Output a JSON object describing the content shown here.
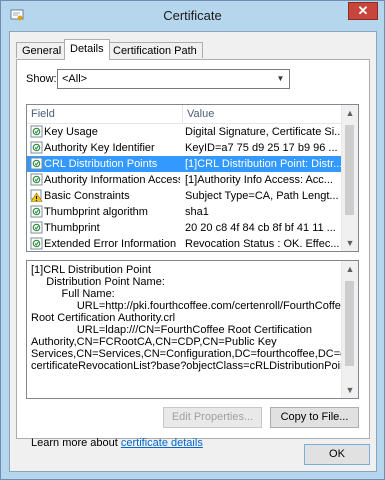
{
  "window": {
    "title": "Certificate",
    "close_glyph": "✕"
  },
  "tabs": [
    {
      "label": "General"
    },
    {
      "label": "Details"
    },
    {
      "label": "Certification Path"
    }
  ],
  "show": {
    "label": "Show:",
    "value": "<All>"
  },
  "list": {
    "columns": [
      "Field",
      "Value"
    ],
    "rows": [
      {
        "icon": "certificate-field-icon",
        "field": "Key Usage",
        "value": "Digital Signature, Certificate Si..."
      },
      {
        "icon": "certificate-field-icon",
        "field": "Authority Key Identifier",
        "value": "KeyID=a7 75 d9 25 17 b9 96 ..."
      },
      {
        "icon": "certificate-field-icon",
        "field": "CRL Distribution Points",
        "value": "[1]CRL Distribution Point: Distr...",
        "selected": true
      },
      {
        "icon": "certificate-field-icon",
        "field": "Authority Information Access",
        "value": "[1]Authority Info Access: Acc..."
      },
      {
        "icon": "warning-icon",
        "field": "Basic Constraints",
        "value": "Subject Type=CA, Path Lengt..."
      },
      {
        "icon": "certificate-field-icon",
        "field": "Thumbprint algorithm",
        "value": "sha1"
      },
      {
        "icon": "certificate-field-icon",
        "field": "Thumbprint",
        "value": "20 20 c8 4f 84 cb 8f bf 41 11 ..."
      },
      {
        "icon": "certificate-field-icon",
        "field": "Extended Error Information",
        "value": "Revocation Status : OK. Effec..."
      }
    ]
  },
  "detail": {
    "lines": [
      "[1]CRL Distribution Point",
      "     Distribution Point Name:",
      "          Full Name:",
      "               URL=http://pki.fourthcoffee.com/certenroll/FourthCoffee",
      "Root Certification Authority.crl",
      "               URL=ldap:///CN=FourthCoffee Root Certification",
      "Authority,CN=FCRootCA,CN=CDP,CN=Public Key",
      "Services,CN=Services,CN=Configuration,DC=fourthcoffee,DC=com?",
      "certificateRevocationList?base?objectClass=cRLDistributionPoint"
    ]
  },
  "buttons": {
    "edit_properties": "Edit Properties...",
    "copy_to_file": "Copy to File...",
    "ok": "OK"
  },
  "learn_more": {
    "prefix": "Learn more about ",
    "link": "certificate details"
  }
}
